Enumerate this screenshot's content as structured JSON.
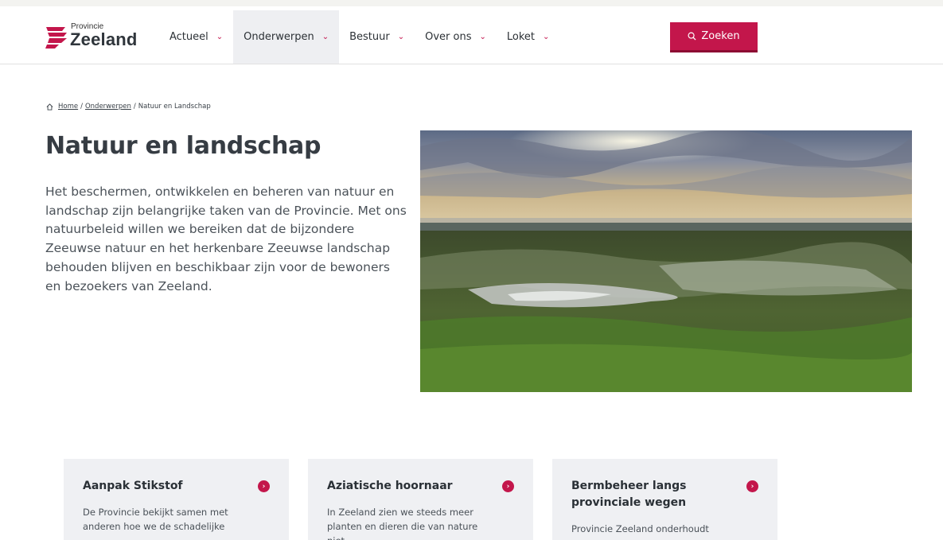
{
  "header": {
    "logo_small": "Provincie",
    "logo_big": "Zeeland",
    "nav": [
      {
        "label": "Actueel",
        "active": false
      },
      {
        "label": "Onderwerpen",
        "active": true
      },
      {
        "label": "Bestuur",
        "active": false
      },
      {
        "label": "Over ons",
        "active": false
      },
      {
        "label": "Loket",
        "active": false
      }
    ],
    "search_label": "Zoeken"
  },
  "breadcrumb": {
    "home": "Home",
    "sep": "/",
    "onderwerpen": "Onderwerpen",
    "current": "Natuur en Landschap"
  },
  "page": {
    "title": "Natuur en landschap",
    "intro": "Het beschermen, ontwikkelen en beheren van natuur en landschap zijn belangrijke taken van de Provincie. Met ons natuurbeleid willen we bereiken dat de bijzondere Zeeuwse natuur en het herkenbare Zeeuwse landschap behouden blijven en beschikbaar zijn voor de bewoners en bezoekers van Zeeland."
  },
  "cards": [
    {
      "title": "Aanpak Stikstof",
      "text": "De Provincie bekijkt samen met anderen hoe we de schadelijke"
    },
    {
      "title": "Aziatische hoornaar",
      "text": "In Zeeland zien we steeds meer planten en dieren die van nature niet"
    },
    {
      "title": "Bermbeheer langs provinciale wegen",
      "text": "Provincie Zeeland onderhoudt"
    }
  ],
  "colors": {
    "accent": "#c3164b",
    "card_bg": "#eff0f3",
    "nav_active_bg": "#eeeff2"
  }
}
